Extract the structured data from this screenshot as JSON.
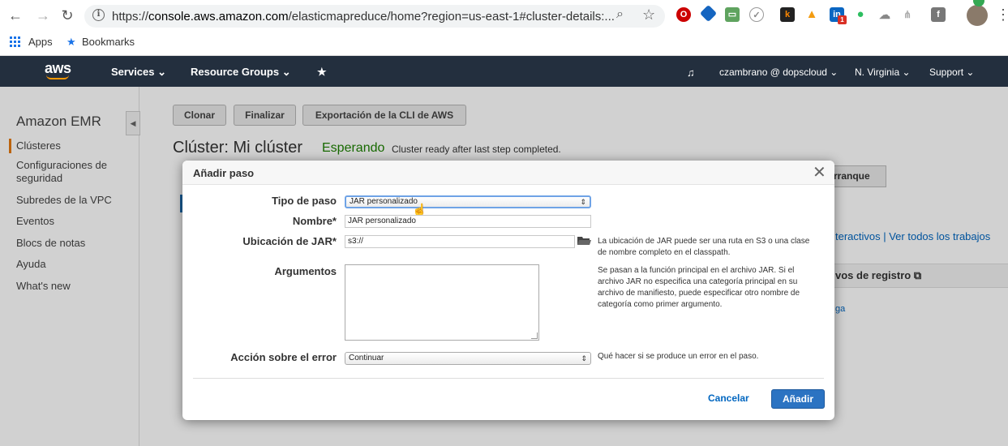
{
  "browser": {
    "url_prefix": "https://",
    "url_domain": "console.aws.amazon.com",
    "url_rest": "/elasticmapreduce/home?region=us-east-1#cluster-details:...",
    "bookmarks": {
      "apps": "Apps",
      "bookmarks": "Bookmarks"
    },
    "extension_badge": "1"
  },
  "aws_nav": {
    "logo": "aws",
    "services": "Services ⌄",
    "resource_groups": "Resource Groups ⌄",
    "pin": "★",
    "bell": "🔔",
    "user": "czambrano @ dopscloud ⌄",
    "region": "N. Virginia ⌄",
    "support": "Support ⌄"
  },
  "sidebar": {
    "title": "Amazon EMR",
    "items": [
      {
        "label": "Clústeres",
        "active": true
      },
      {
        "label": "Configuraciones de seguridad"
      },
      {
        "label": "Subredes de la VPC"
      },
      {
        "label": "Eventos"
      },
      {
        "label": "Blocs de notas"
      },
      {
        "label": "Ayuda"
      },
      {
        "label": "What's new"
      }
    ]
  },
  "toolbar": {
    "clone": "Clonar",
    "terminate": "Finalizar",
    "cli_export": "Exportación de la CLI de AWS"
  },
  "cluster": {
    "title": "Clúster: Mi clúster",
    "status": "Esperando",
    "status_message": "Cluster ready after last step completed."
  },
  "background": {
    "tab_partial": "rranque",
    "links_partial": "teractivos | Ver todos los trabajos",
    "panel_partial": "vos de registro",
    "link2_partial": "ga"
  },
  "modal": {
    "title": "Añadir paso",
    "close": "✕",
    "step_type": {
      "label": "Tipo de paso",
      "value": "JAR personalizado"
    },
    "name": {
      "label": "Nombre*",
      "value": "JAR personalizado"
    },
    "jar_location": {
      "label": "Ubicación de JAR*",
      "value": "s3://",
      "help": "La ubicación de JAR puede ser una ruta en S3 o una clase de nombre completo en el classpath."
    },
    "arguments": {
      "label": "Argumentos",
      "value": "",
      "help": "Se pasan a la función principal en el archivo JAR. Si el archivo JAR no especifica una categoría principal en su archivo de manifiesto, puede especificar otro nombre de categoría como primer argumento."
    },
    "action_on_failure": {
      "label": "Acción sobre el error",
      "value": "Continuar",
      "help": "Qué hacer si se produce un error en el paso."
    },
    "cancel": "Cancelar",
    "add": "Añadir"
  },
  "colors": {
    "aws_nav_bg": "#232f3e",
    "aws_orange": "#ff9900",
    "status_green": "#1d8102",
    "primary_blue": "#2b73c2",
    "link_blue": "#0066c0"
  }
}
